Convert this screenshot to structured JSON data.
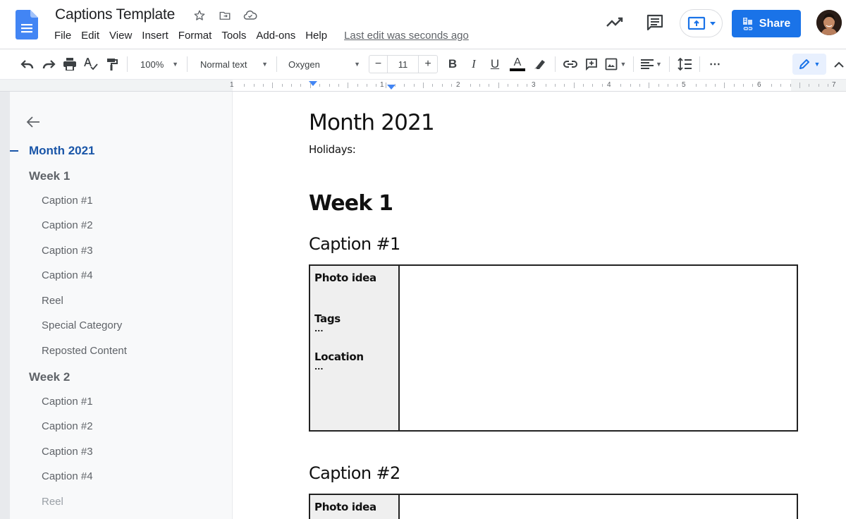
{
  "header": {
    "title": "Captions Template",
    "title_icons": [
      "star-icon",
      "move-to-folder-icon",
      "cloud-saved-icon"
    ],
    "menu": [
      "File",
      "Edit",
      "View",
      "Insert",
      "Format",
      "Tools",
      "Add-ons",
      "Help"
    ],
    "last_edit": "Last edit was seconds ago",
    "share_label": "Share",
    "brand_color": "#1a73e8"
  },
  "toolbar": {
    "zoom": "100%",
    "style": "Normal text",
    "font": "Oxygen",
    "font_size": "11",
    "minus": "−",
    "plus": "+",
    "bold": "B",
    "italic": "I",
    "underline": "U",
    "text_color": "A",
    "more": "⋯"
  },
  "ruler": {
    "labels": [
      "1",
      "1",
      "2",
      "3",
      "4",
      "5",
      "6",
      "7"
    ]
  },
  "outline": {
    "items": [
      {
        "label": "Month 2021",
        "level": "h1"
      },
      {
        "label": "Week 1",
        "level": "h2"
      },
      {
        "label": "Caption #1",
        "level": "h3"
      },
      {
        "label": "Caption #2",
        "level": "h3"
      },
      {
        "label": "Caption #3",
        "level": "h3"
      },
      {
        "label": "Caption #4",
        "level": "h3"
      },
      {
        "label": "Reel",
        "level": "h3"
      },
      {
        "label": "Special Category",
        "level": "h3"
      },
      {
        "label": "Reposted Content",
        "level": "h3"
      },
      {
        "label": "Week 2",
        "level": "h2"
      },
      {
        "label": "Caption #1",
        "level": "h3"
      },
      {
        "label": "Caption #2",
        "level": "h3"
      },
      {
        "label": "Caption #3",
        "level": "h3"
      },
      {
        "label": "Caption #4",
        "level": "h3"
      },
      {
        "label": "Reel",
        "level": "h3"
      }
    ]
  },
  "document": {
    "title": "Month 2021",
    "holidays": "Holidays:",
    "week1": "Week 1",
    "caption1": {
      "heading": "Caption #1",
      "photo_idea": "Photo idea",
      "tags": "Tags",
      "tags_value": "...",
      "location": "Location",
      "location_value": "..."
    },
    "caption2": {
      "heading": "Caption #2",
      "photo_idea": "Photo idea"
    }
  }
}
